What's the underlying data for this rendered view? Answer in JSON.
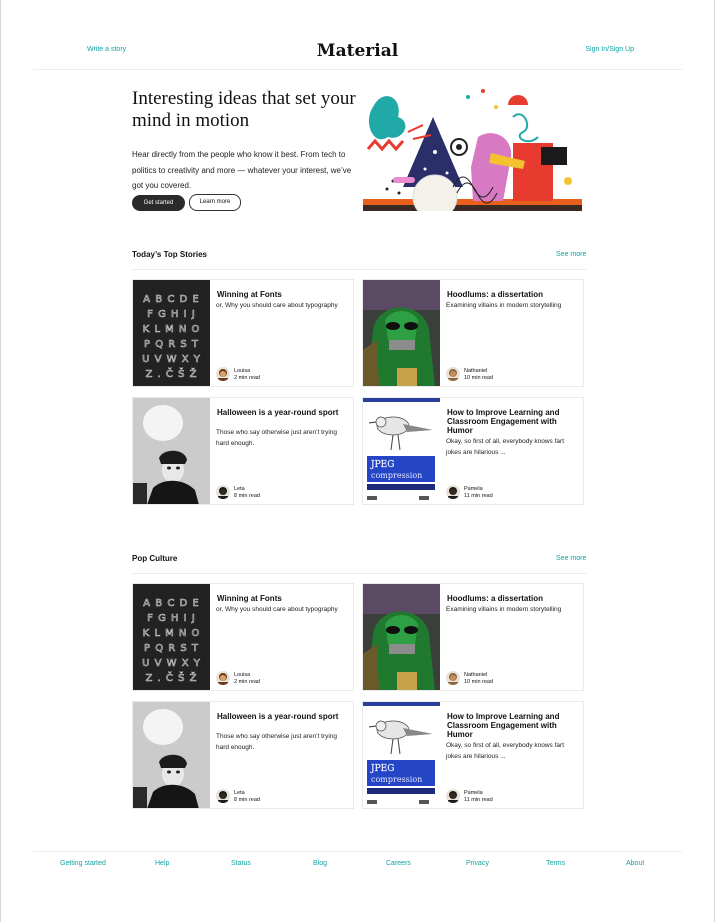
{
  "header": {
    "write_story": "Write a story",
    "brand": "Material",
    "sign_in": "Sign In/Sign Up"
  },
  "hero": {
    "title": "Interesting ideas that set your mind in motion",
    "text": "Hear directly from the people who know it best. From tech to politics to creativity and more — whatever your interest, we’ve got you covered.",
    "primary_button": "Get started",
    "secondary_button": "Learn more"
  },
  "sections": [
    {
      "title": "Today’s Top Stories",
      "see_more": "See more",
      "cards": [
        {
          "title": "Winning at Fonts",
          "description": "or, Why you should care about typography",
          "author": "Louisa",
          "read_time": "2 min read",
          "thumb": "font-specimen"
        },
        {
          "title": "Hoodlums: a dissertation",
          "description": "Examining villains in modern storytelling",
          "author": "Nathaniel",
          "read_time": "10 min read",
          "thumb": "villain"
        },
        {
          "title": "Halloween is a year-round sport",
          "description": "Those who say otherwise just aren’t trying hard enough.",
          "author": "Leta",
          "read_time": "8 min read",
          "thumb": "ghost-photo"
        },
        {
          "title": "How to Improve Learning and Classroom Engagement with Humor",
          "description": "Okay, so first of all, everybody knows fart jokes are hilarious ...",
          "author": "Pamela",
          "read_time": "11 min read",
          "thumb": "jpeg-bird"
        }
      ]
    },
    {
      "title": "Pop Culture",
      "see_more": "See more",
      "cards": [
        {
          "title": "Winning at Fonts",
          "description": "or, Why you should care about typography",
          "author": "Louisa",
          "read_time": "2 min read",
          "thumb": "font-specimen"
        },
        {
          "title": "Hoodlums: a dissertation",
          "description": "Examining villains in modern storytelling",
          "author": "Nathaniel",
          "read_time": "10 min read",
          "thumb": "villain"
        },
        {
          "title": "Halloween is a year-round sport",
          "description": "Those who say otherwise just aren’t trying hard enough.",
          "author": "Leta",
          "read_time": "8 min read",
          "thumb": "ghost-photo"
        },
        {
          "title": "How to Improve Learning and Classroom Engagement with Humor",
          "description": "Okay, so first of all, everybody knows fart jokes are hilarious ...",
          "author": "Pamela",
          "read_time": "11 min read",
          "thumb": "jpeg-bird"
        }
      ]
    }
  ],
  "thumbs": {
    "font_specimen_rows": [
      "A B C D E",
      "F G H I J",
      "K L M N O",
      "P Q R S T",
      "U V W X Y",
      "Z . Č Š Ž"
    ],
    "jpeg_line1": "JPEG",
    "jpeg_line2": "compression"
  },
  "footer": [
    "Getting started",
    "Help",
    "Status",
    "Blog",
    "Careers",
    "Privacy",
    "Terms",
    "About"
  ],
  "colors": {
    "accent": "#12a3a3",
    "text": "#111111",
    "primary_button": "#2a2a2a"
  }
}
